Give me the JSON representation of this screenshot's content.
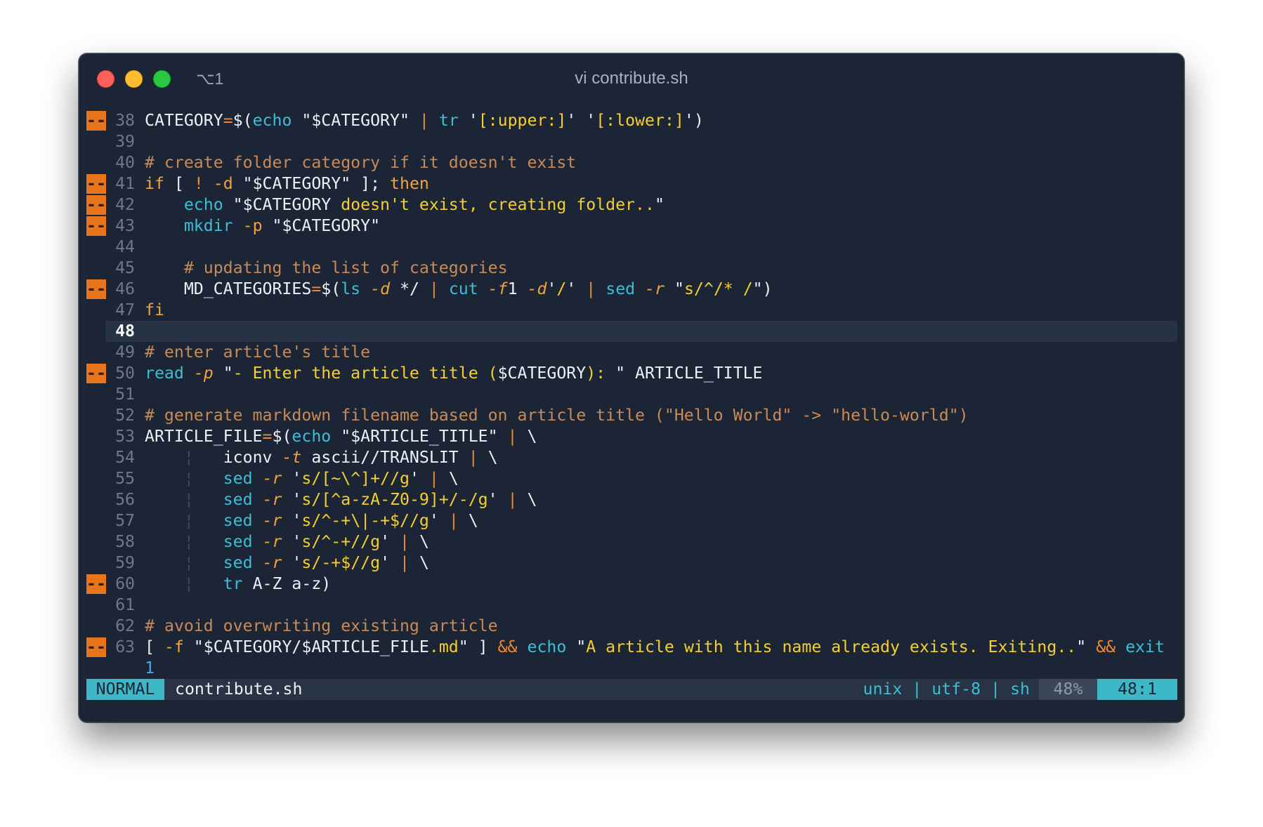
{
  "window": {
    "title": "vi contribute.sh",
    "tab_shortcut": "⌥1"
  },
  "theme": {
    "background": "#1b2536",
    "cursorline": "#273244",
    "statusline": "#283345",
    "text": "#eef1f4",
    "line_number": "#6d7889",
    "line_number_current": "#f4f6f8",
    "command": "#3cbfd6",
    "string": "#f5cf2f",
    "comment": "#c98a55",
    "keyword": "#f1a43c",
    "operator": "#ec8a2c",
    "option": "#f4a13b",
    "number": "#4aa8e8",
    "indent_guide": "#3e4b5e",
    "marker": "#e8751a",
    "mode": "#3db8c6",
    "percent_box": "#3b4758",
    "percent_text": "#8d99a8",
    "close_button": "#fe5f57",
    "minimize_button": "#febc2e",
    "zoom_button": "#28c840"
  },
  "editor": {
    "rows": [
      {
        "number": "38",
        "marker": "--",
        "tokens": [
          {
            "plain": "CATEGORY"
          },
          {
            "op": "="
          },
          {
            "plain": "$("
          },
          {
            "cmd": "echo"
          },
          {
            "plain": " \"$CATEGORY\" "
          },
          {
            "op": "|"
          },
          {
            "plain": " "
          },
          {
            "cmd": "tr"
          },
          {
            "plain": " '"
          },
          {
            "str": "[:upper:]"
          },
          {
            "plain": "' '"
          },
          {
            "str": "[:lower:]"
          },
          {
            "plain": "')"
          }
        ]
      },
      {
        "number": "39",
        "tokens": []
      },
      {
        "number": "40",
        "tokens": [
          {
            "cmt": "# create folder category if it doesn't exist"
          }
        ]
      },
      {
        "number": "41",
        "marker": "--",
        "tokens": [
          {
            "kw": "if"
          },
          {
            "plain": " [ "
          },
          {
            "op": "!"
          },
          {
            "plain": " "
          },
          {
            "opt": "-d"
          },
          {
            "plain": " \"$CATEGORY\" ]; "
          },
          {
            "kw": "then"
          }
        ]
      },
      {
        "number": "42",
        "marker": "--",
        "tokens": [
          {
            "plain": "    "
          },
          {
            "cmd": "echo"
          },
          {
            "plain": " \"$CATEGORY"
          },
          {
            "str": " doesn't exist, creating folder.."
          },
          {
            "plain": "\""
          }
        ]
      },
      {
        "number": "43",
        "marker": "--",
        "tokens": [
          {
            "plain": "    "
          },
          {
            "cmd": "mkdir"
          },
          {
            "plain": " "
          },
          {
            "opt": "-p"
          },
          {
            "plain": " \"$CATEGORY\""
          }
        ]
      },
      {
        "number": "44",
        "tokens": []
      },
      {
        "number": "45",
        "tokens": [
          {
            "plain": "    "
          },
          {
            "cmt": "# updating the list of categories"
          }
        ]
      },
      {
        "number": "46",
        "marker": "--",
        "tokens": [
          {
            "plain": "    MD_CATEGORIES"
          },
          {
            "op": "="
          },
          {
            "plain": "$("
          },
          {
            "cmd": "ls"
          },
          {
            "plain": " "
          },
          {
            "arg": "-d"
          },
          {
            "plain": " */ "
          },
          {
            "op": "|"
          },
          {
            "plain": " "
          },
          {
            "cmd": "cut"
          },
          {
            "plain": " "
          },
          {
            "arg": "-f"
          },
          {
            "plain": "1 "
          },
          {
            "arg": "-d"
          },
          {
            "plain": "'"
          },
          {
            "str": "/"
          },
          {
            "plain": "' "
          },
          {
            "op": "|"
          },
          {
            "plain": " "
          },
          {
            "cmd": "sed"
          },
          {
            "plain": " "
          },
          {
            "arg": "-r"
          },
          {
            "plain": " \""
          },
          {
            "str": "s/^/* /"
          },
          {
            "plain": "\")"
          }
        ]
      },
      {
        "number": "47",
        "tokens": [
          {
            "kw": "fi"
          }
        ]
      },
      {
        "number": "48",
        "current": true,
        "tokens": []
      },
      {
        "number": "49",
        "tokens": [
          {
            "cmt": "# enter article's title"
          }
        ]
      },
      {
        "number": "50",
        "marker": "--",
        "tokens": [
          {
            "cmd": "read"
          },
          {
            "plain": " "
          },
          {
            "arg": "-p"
          },
          {
            "plain": " \""
          },
          {
            "str": "- Enter the article title ("
          },
          {
            "plain": "$CATEGORY"
          },
          {
            "str": "): "
          },
          {
            "plain": "\" ARTICLE_TITLE"
          }
        ]
      },
      {
        "number": "51",
        "tokens": []
      },
      {
        "number": "52",
        "tokens": [
          {
            "cmt": "# generate markdown filename based on article title (\"Hello World\" -> \"hello-world\")"
          }
        ]
      },
      {
        "number": "53",
        "tokens": [
          {
            "plain": "ARTICLE_FILE"
          },
          {
            "op": "="
          },
          {
            "plain": "$("
          },
          {
            "cmd": "echo"
          },
          {
            "plain": " \"$ARTICLE_TITLE\" "
          },
          {
            "op": "|"
          },
          {
            "plain": " \\"
          }
        ]
      },
      {
        "number": "54",
        "tokens": [
          {
            "plain": "    "
          },
          {
            "guide": "¦"
          },
          {
            "plain": "   iconv "
          },
          {
            "arg": "-t"
          },
          {
            "plain": " ascii//TRANSLIT "
          },
          {
            "op": "|"
          },
          {
            "plain": " \\"
          }
        ]
      },
      {
        "number": "55",
        "tokens": [
          {
            "plain": "    "
          },
          {
            "guide": "¦"
          },
          {
            "plain": "   "
          },
          {
            "cmd": "sed"
          },
          {
            "plain": " "
          },
          {
            "arg": "-r"
          },
          {
            "plain": " '"
          },
          {
            "str": "s/[~\\^]+//g"
          },
          {
            "plain": "' "
          },
          {
            "op": "|"
          },
          {
            "plain": " \\"
          }
        ]
      },
      {
        "number": "56",
        "tokens": [
          {
            "plain": "    "
          },
          {
            "guide": "¦"
          },
          {
            "plain": "   "
          },
          {
            "cmd": "sed"
          },
          {
            "plain": " "
          },
          {
            "arg": "-r"
          },
          {
            "plain": " '"
          },
          {
            "str": "s/[^a-zA-Z0-9]+/-/g"
          },
          {
            "plain": "' "
          },
          {
            "op": "|"
          },
          {
            "plain": " \\"
          }
        ]
      },
      {
        "number": "57",
        "tokens": [
          {
            "plain": "    "
          },
          {
            "guide": "¦"
          },
          {
            "plain": "   "
          },
          {
            "cmd": "sed"
          },
          {
            "plain": " "
          },
          {
            "arg": "-r"
          },
          {
            "plain": " '"
          },
          {
            "str": "s/^-+\\|-+$//g"
          },
          {
            "plain": "' "
          },
          {
            "op": "|"
          },
          {
            "plain": " \\"
          }
        ]
      },
      {
        "number": "58",
        "tokens": [
          {
            "plain": "    "
          },
          {
            "guide": "¦"
          },
          {
            "plain": "   "
          },
          {
            "cmd": "sed"
          },
          {
            "plain": " "
          },
          {
            "arg": "-r"
          },
          {
            "plain": " '"
          },
          {
            "str": "s/^-+//g"
          },
          {
            "plain": "' "
          },
          {
            "op": "|"
          },
          {
            "plain": " \\"
          }
        ]
      },
      {
        "number": "59",
        "tokens": [
          {
            "plain": "    "
          },
          {
            "guide": "¦"
          },
          {
            "plain": "   "
          },
          {
            "cmd": "sed"
          },
          {
            "plain": " "
          },
          {
            "arg": "-r"
          },
          {
            "plain": " '"
          },
          {
            "str": "s/-+$//g"
          },
          {
            "plain": "' "
          },
          {
            "op": "|"
          },
          {
            "plain": " \\"
          }
        ]
      },
      {
        "number": "60",
        "marker": "--",
        "tokens": [
          {
            "plain": "    "
          },
          {
            "guide": "¦"
          },
          {
            "plain": "   "
          },
          {
            "cmd": "tr"
          },
          {
            "plain": " A-Z a-z)"
          }
        ]
      },
      {
        "number": "61",
        "tokens": []
      },
      {
        "number": "62",
        "tokens": [
          {
            "cmt": "# avoid overwriting existing article"
          }
        ]
      },
      {
        "number": "63",
        "marker": "--",
        "tokens": [
          {
            "plain": "[ "
          },
          {
            "opt": "-f"
          },
          {
            "plain": " \"$CATEGORY/$ARTICLE_FILE"
          },
          {
            "str": ".md"
          },
          {
            "plain": "\" ] "
          },
          {
            "op": "&&"
          },
          {
            "plain": " "
          },
          {
            "cmd": "echo"
          },
          {
            "plain": " \""
          },
          {
            "str": "A article with this name already exists. Exiting.."
          },
          {
            "plain": "\" "
          },
          {
            "op": "&&"
          },
          {
            "plain": " "
          },
          {
            "cmd": "exit"
          }
        ]
      },
      {
        "number": "",
        "tokens": [
          {
            "num": "1"
          }
        ]
      }
    ]
  },
  "statusline": {
    "mode": "NORMAL",
    "filename": "contribute.sh",
    "fileformat": "unix",
    "separator": "|",
    "encoding": "utf-8",
    "filetype": "sh",
    "percent": "48%",
    "position": "48:1"
  }
}
